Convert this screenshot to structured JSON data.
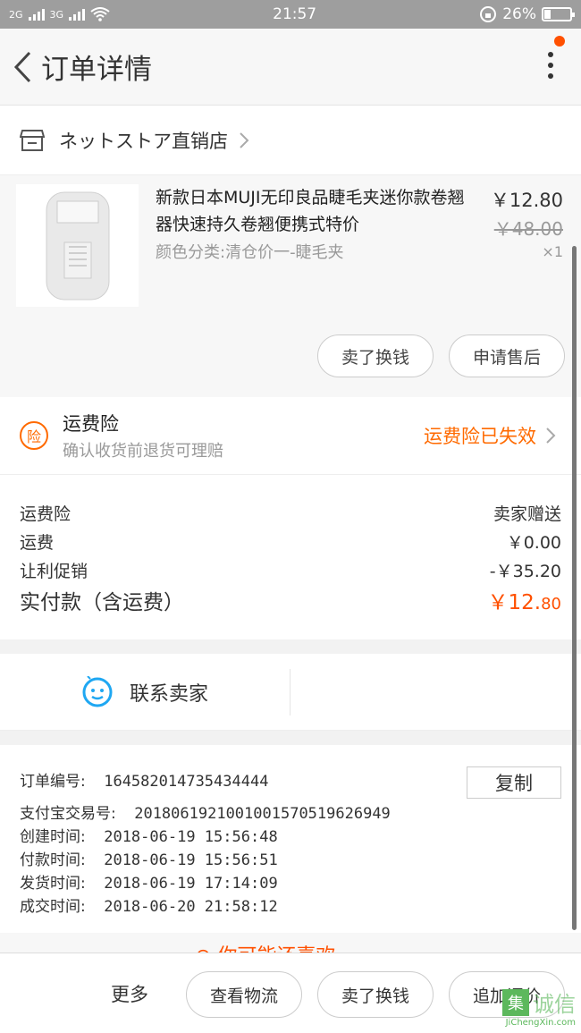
{
  "status": {
    "signal1": "2G",
    "signal2": "3G",
    "time": "21:57",
    "battery": "26%",
    "battery_level": 0.26
  },
  "nav": {
    "title": "订单详情"
  },
  "shop": {
    "name": "ネットストア直销店"
  },
  "item": {
    "title": "新款日本MUJI无印良品睫毛夹迷你款卷翘器快速持久卷翘便携式特价",
    "spec": "颜色分类:清仓价一-睫毛夹",
    "price": "￥12.80",
    "original_price": "￥48.00",
    "qty": "×1",
    "btn_sell": "卖了换钱",
    "btn_aftersale": "申请售后"
  },
  "insurance": {
    "icon_char": "险",
    "title": "运费险",
    "subtitle": "确认收货前退货可理赔",
    "status": "运费险已失效"
  },
  "fees": {
    "rows": [
      {
        "label": "运费险",
        "value": "卖家赠送"
      },
      {
        "label": "运费",
        "value": "￥0.00"
      },
      {
        "label": "让利促销",
        "value": "-￥35.20"
      }
    ],
    "total_label": "实付款（含运费）",
    "total_value_main": "￥12.",
    "total_value_cents": "80"
  },
  "contact": {
    "label": "联系卖家"
  },
  "order_info": {
    "copy_label": "复制",
    "rows": [
      {
        "label": "订单编号:",
        "value": "164582014735434444"
      },
      {
        "label": "支付宝交易号:",
        "value": "2018061921001001570519626949"
      },
      {
        "label": "创建时间:",
        "value": "2018-06-19 15:56:48"
      },
      {
        "label": "付款时间:",
        "value": "2018-06-19 15:56:51"
      },
      {
        "label": "发货时间:",
        "value": "2018-06-19 17:14:09"
      },
      {
        "label": "成交时间:",
        "value": "2018-06-20 21:58:12"
      }
    ]
  },
  "partial_text": "⊙ 你可能还喜欢",
  "bottom": {
    "more": "更多",
    "btn_logistics": "查看物流",
    "btn_sell": "卖了换钱",
    "btn_review": "追加评价"
  },
  "watermark": {
    "logo": "集",
    "text": "诚信",
    "url": "JiChengXin.com"
  },
  "colors": {
    "accent": "#ff5000",
    "insurance": "#ff6a00",
    "contact_icon": "#1ea7f2"
  }
}
